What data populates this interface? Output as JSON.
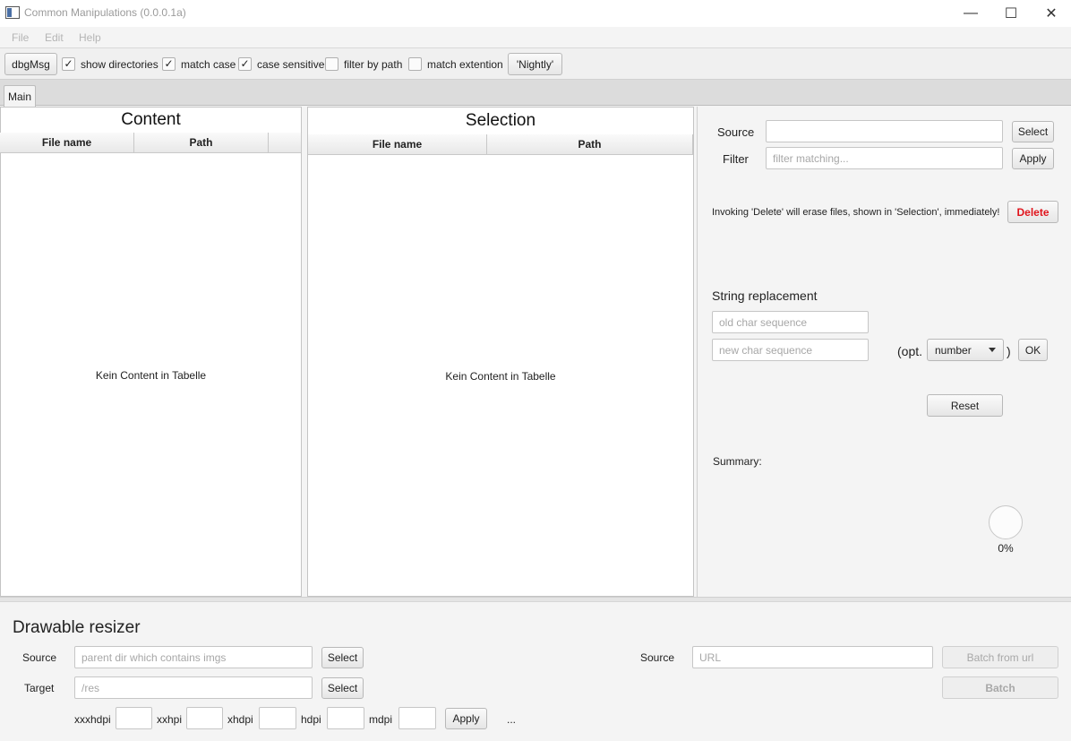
{
  "window": {
    "title": "Common Manipulations (0.0.0.1a)",
    "minimize_glyph": "—",
    "maximize_glyph": "☐",
    "close_glyph": "✕"
  },
  "menu": {
    "items": [
      "File",
      "Edit",
      "Help"
    ]
  },
  "toolbar": {
    "dbg_label": "dbgMsg",
    "checkboxes": [
      {
        "label": "show directories",
        "checked": true
      },
      {
        "label": "match case",
        "checked": true
      },
      {
        "label": "case sensitive",
        "checked": true
      },
      {
        "label": "filter by path",
        "checked": false
      },
      {
        "label": "match extention",
        "checked": false
      }
    ],
    "check_glyph": "✓",
    "nightly_label": "'Nightly'"
  },
  "tabs": [
    {
      "label": "Main",
      "active": true
    }
  ],
  "content_pane": {
    "title": "Content",
    "columns": [
      "File name",
      "Path"
    ],
    "empty_text": "Kein Content in Tabelle"
  },
  "selection_pane": {
    "title": "Selection",
    "columns": [
      "File name",
      "Path"
    ],
    "empty_text": "Kein Content in Tabelle"
  },
  "right_panel": {
    "source_label": "Source",
    "source_value": "",
    "select_label": "Select",
    "filter_label": "Filter",
    "filter_placeholder": "filter matching...",
    "apply_label": "Apply",
    "delete_warning": "Invoking 'Delete' will erase files, shown in 'Selection', immediately!",
    "delete_label": "Delete",
    "string_replacement_heading": "String replacement",
    "old_placeholder": "old char sequence",
    "new_placeholder": "new char sequence",
    "opt_prefix": "(opt.",
    "opt_select_value": "number",
    "opt_suffix": ")",
    "ok_label": "OK",
    "reset_label": "Reset",
    "summary_label": "Summary:",
    "progress_text": "0%",
    "progress_value": 0
  },
  "drawable_resizer": {
    "heading": "Drawable resizer",
    "source_label": "Source",
    "source_placeholder": "parent dir which contains imgs",
    "select_label": "Select",
    "target_label": "Target",
    "target_placeholder": "/res",
    "select2_label": "Select",
    "densities": [
      "xxxhdpi",
      "xxhpi",
      "xhdpi",
      "hdpi",
      "mdpi"
    ],
    "apply_label": "Apply",
    "ellipsis": "...",
    "url_source_label": "Source",
    "url_placeholder": "URL",
    "batch_from_url_label": "Batch from url",
    "batch_label": "Batch"
  },
  "colors": {
    "delete_red": "#e0141c",
    "disabled_text": "#a8a8a8"
  }
}
